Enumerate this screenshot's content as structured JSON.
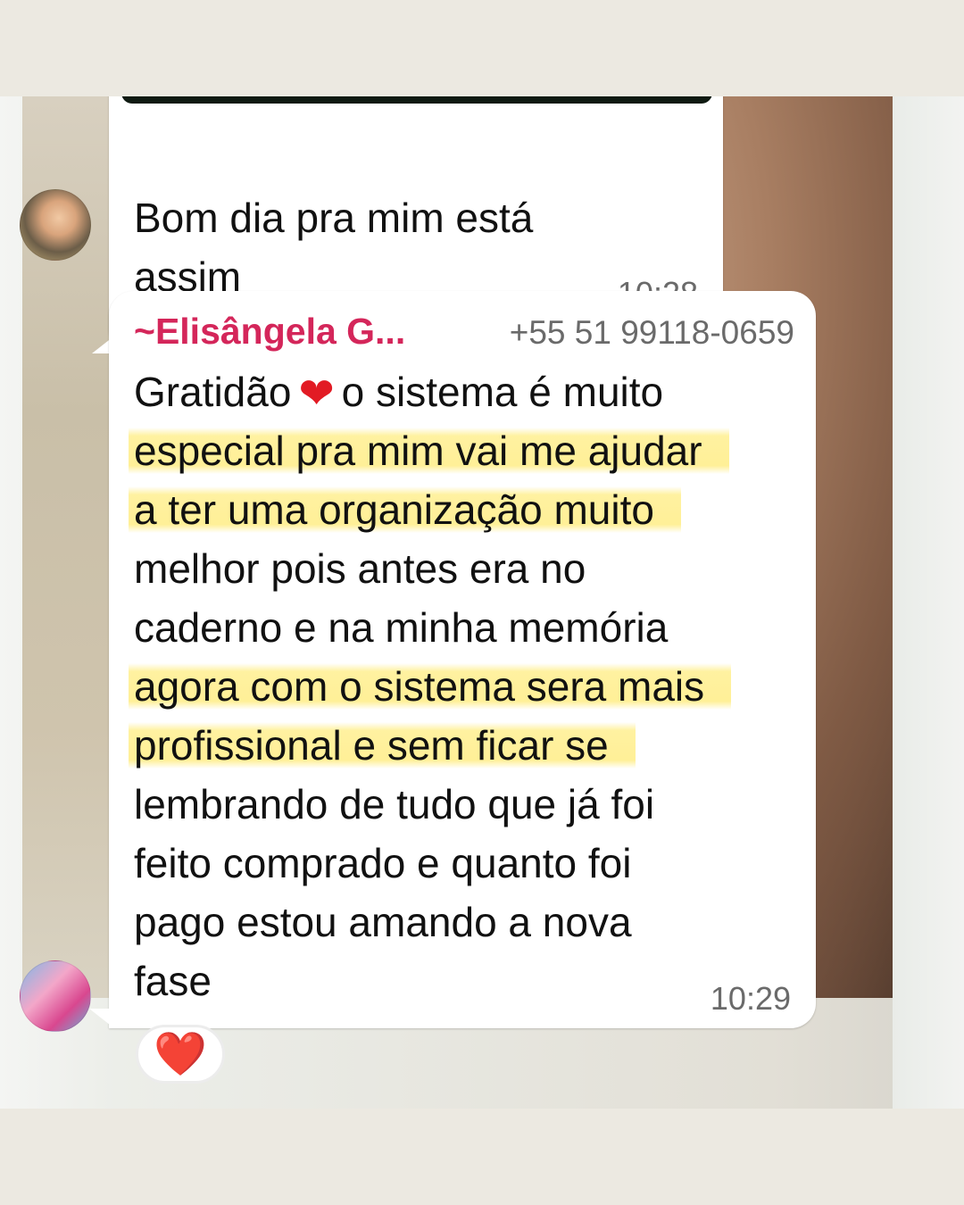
{
  "messages": [
    {
      "text": "Bom dia pra mim está assim",
      "time": "10:28"
    },
    {
      "sender_name": "~Elisângela G...",
      "sender_phone": "+55 51 99118-0659",
      "lines": [
        "Gratidão",
        "o sistema é  muito",
        "especial pra mim vai me ajudar",
        "a ter uma organização  muito",
        "melhor pois antes era no",
        "caderno e na minha  memória",
        "agora com o sistema sera mais",
        "profissional  e sem ficar se",
        "lembrando  de tudo que já  foi",
        "feito comprado e quanto foi",
        "pago estou amando a nova",
        "fase"
      ],
      "time": "10:29",
      "highlighted_lines": [
        2,
        3,
        6,
        7
      ],
      "reaction": "❤️"
    }
  ],
  "colors": {
    "sender_name": "#d4265a",
    "highlight": "#fff09a",
    "heart": "#e21b24"
  },
  "icons": {
    "inline_heart": "heart-emoji",
    "reaction_heart": "heart-emoji"
  }
}
